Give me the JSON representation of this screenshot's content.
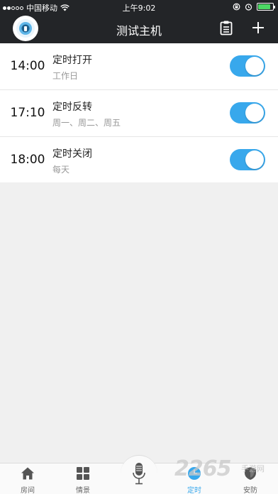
{
  "status_bar": {
    "carrier": "中国移动",
    "time": "上午9:02",
    "battery_level": 0.85
  },
  "header": {
    "title": "测试主机",
    "icons": [
      "avatar",
      "clipboard-icon",
      "plus-icon"
    ]
  },
  "timers": [
    {
      "time": "14:00",
      "name": "定时打开",
      "repeat": "工作日",
      "enabled": true
    },
    {
      "time": "17:10",
      "name": "定时反转",
      "repeat": "周一、周二、周五",
      "enabled": true
    },
    {
      "time": "18:00",
      "name": "定时关闭",
      "repeat": "每天",
      "enabled": true
    }
  ],
  "tabbar": {
    "tabs": [
      {
        "label": "房间",
        "icon": "home-icon",
        "active": false
      },
      {
        "label": "情景",
        "icon": "grid-icon",
        "active": false
      },
      {
        "label": "",
        "icon": "microphone-icon",
        "active": false
      },
      {
        "label": "定时",
        "icon": "clock-icon",
        "active": true
      },
      {
        "label": "安防",
        "icon": "shield-icon",
        "active": false
      }
    ]
  },
  "watermark": {
    "brand": "2265",
    "sub": "手游网"
  },
  "colors": {
    "header_bg": "#232528",
    "accent": "#38a8ec",
    "background": "#f0f0f0"
  }
}
